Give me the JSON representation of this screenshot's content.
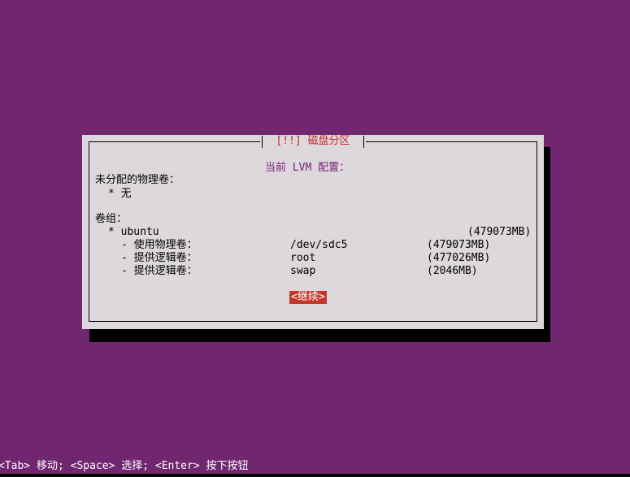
{
  "dialog": {
    "title": "[!!] 磁盘分区",
    "subtitle": "当前 LVM 配置：",
    "unallocated_pv_label": "未分配的物理卷：",
    "unallocated_pv_value": "* 无",
    "volume_groups_label": "卷组：",
    "volume_group": {
      "name": "* ubuntu",
      "size": "(479073MB)",
      "entries": [
        {
          "label": "- 使用物理卷：",
          "name": "/dev/sdc5",
          "size": "(479073MB)"
        },
        {
          "label": "- 提供逻辑卷：",
          "name": "root",
          "size": "(477026MB)"
        },
        {
          "label": "- 提供逻辑卷：",
          "name": "swap",
          "size": "(2046MB)"
        }
      ]
    },
    "continue_button": "<继续>"
  },
  "footer": {
    "hint": "<Tab> 移动; <Space> 选择; <Enter> 按下按钮"
  },
  "colors": {
    "background": "#712670",
    "dialog": "#dcd8dc",
    "title": "#c4282c",
    "subtitle": "#7a1d78",
    "button": "#c4382c"
  }
}
